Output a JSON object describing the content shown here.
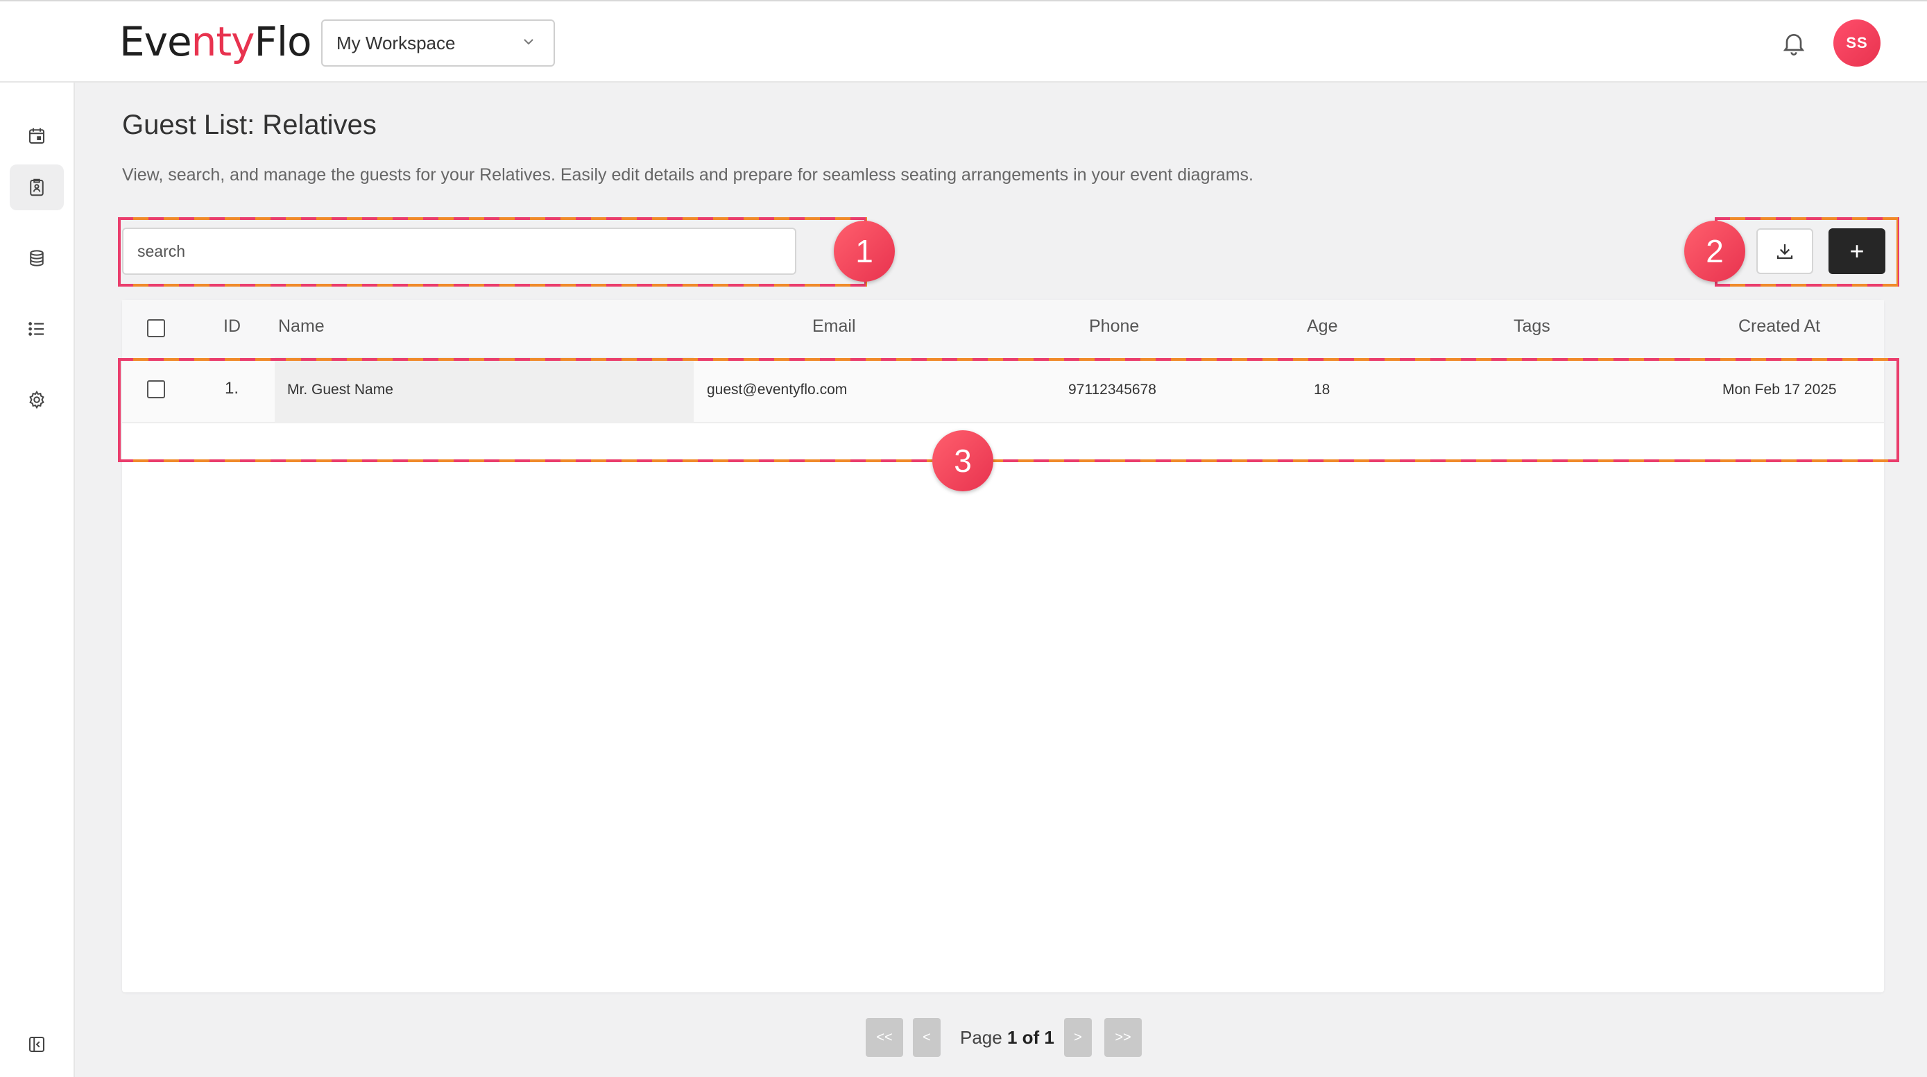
{
  "header": {
    "logo_prefix": "Eve",
    "logo_accent": "nty",
    "logo_suffix": "Flo",
    "workspace": "My Workspace",
    "avatar_initials": "SS"
  },
  "sidebar": {
    "items": [
      {
        "icon": "calendar-icon",
        "active": false
      },
      {
        "icon": "guest-list-icon",
        "active": true
      },
      {
        "icon": "database-icon",
        "active": false
      },
      {
        "icon": "list-icon",
        "active": false
      },
      {
        "icon": "gear-icon",
        "active": false
      },
      {
        "icon": "collapse-sidebar-icon",
        "active": false
      }
    ]
  },
  "page": {
    "title": "Guest List: Relatives",
    "description": "View, search, and manage the guests for your Relatives. Easily edit details and prepare for seamless seating arrangements in your event diagrams."
  },
  "search": {
    "placeholder": "search",
    "value": ""
  },
  "actions": {
    "download_icon": "download-icon",
    "add_label": "+"
  },
  "table": {
    "columns": [
      "ID",
      "Name",
      "Email",
      "Phone",
      "Age",
      "Tags",
      "Created At"
    ],
    "rows": [
      {
        "id": "1.",
        "name": "Mr. Guest Name",
        "email": "guest@eventyflo.com",
        "phone": "97112345678",
        "age": "18",
        "tags": "",
        "created_at": "Mon Feb 17 2025"
      }
    ]
  },
  "annotations": {
    "badge1": "1",
    "badge2": "2",
    "badge3": "3"
  },
  "pagination": {
    "first": "<<",
    "prev": "<",
    "label": "Page",
    "current": "1 of 1",
    "next": ">",
    "last": ">>"
  },
  "colors": {
    "accent": "#e8334f",
    "annotation_dash": "#ea3d6c",
    "annotation_dash_alt": "#f08a2a",
    "primary_button": "#262626"
  }
}
